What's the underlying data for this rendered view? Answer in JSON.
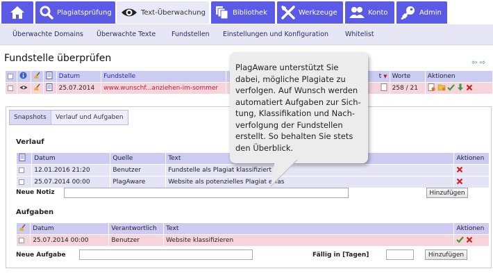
{
  "nav": {
    "tabs": [
      {
        "label": "",
        "icon": "home-icon"
      },
      {
        "label": "Plagiatsprüfung",
        "icon": "search-icon"
      },
      {
        "label": "Text-Überwachung",
        "icon": "eye-icon"
      },
      {
        "label": "Bibliothek",
        "icon": "library-icon"
      },
      {
        "label": "Werkzeuge",
        "icon": "tools-icon"
      },
      {
        "label": "Konto",
        "icon": "users-icon"
      },
      {
        "label": "Admin",
        "icon": "key-icon"
      }
    ]
  },
  "subnav": {
    "items": [
      "Überwachte Domains",
      "Überwachte Texte",
      "Fundstellen",
      "Einstellungen und Konfiguration",
      "Whitelist"
    ]
  },
  "page": {
    "title": "Fundstelle überprüfen",
    "nav_arrows": "⇦ ⇨"
  },
  "fund_table": {
    "headers": [
      "Datum",
      "Fundstelle",
      "t",
      "Worte",
      "Aktionen"
    ],
    "row": {
      "datum": "25.07.2014",
      "fundstelle": "www.wunschf...anziehen-im-sommer",
      "worte": "258 / 21"
    }
  },
  "panel": {
    "tabs": [
      "Snapshots",
      "Verlauf und Aufgaben"
    ],
    "verlauf": {
      "title": "Verlauf",
      "headers": [
        "Datum",
        "Quelle",
        "Text",
        "Aktionen"
      ],
      "rows": [
        {
          "datum": "12.01.2016 21:20",
          "quelle": "Benutzer",
          "text": "Fundstelle als Plagiat klassifiziert"
        },
        {
          "datum": "25.07.2014 00:00",
          "quelle": "PlagAware",
          "text": "Website als potenzielles Plagiat erfas"
        }
      ],
      "note_label": "Neue Notiz",
      "add_label": "Hinzufügen"
    },
    "aufgaben": {
      "title": "Aufgaben",
      "headers": [
        "Datum",
        "Verantwortlich",
        "Text",
        "Aktionen"
      ],
      "rows": [
        {
          "datum": "25.07.2014 00:00",
          "verantwortlich": "Benutzer",
          "text": "Website klassifizieren"
        }
      ],
      "task_label": "Neue Aufgabe",
      "due_label": "Fällig in [Tagen]",
      "add_label": "Hinzufügen"
    }
  },
  "bubble": {
    "text": "PlagAware unterstützt Sie dabei, mögliche Plagiate zu verfolgen. Auf Wunsch werden automatiert Aufgaben zur Sich-tung, Klassifikation und  Nach-verfolgung der Fundstellen erstellt. So behalten Sie stets den Überblick."
  },
  "colors": {
    "nav": "#5a5ae6",
    "subnav": "#e6e6f5",
    "header": "#ccccf2",
    "pink": "#f6d4dc",
    "lavender": "#e4e4f6"
  }
}
